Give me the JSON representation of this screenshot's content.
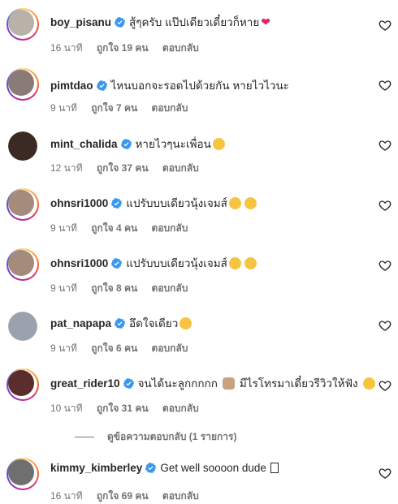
{
  "comments": [
    {
      "username": "boy_pisanu",
      "text": "สู้ๆครับ แป๊ปเดียวเดี๋ยวก็หาย",
      "emojis": [
        "heart"
      ],
      "time": "16 นาที",
      "likes": "ถูกใจ 19 คน",
      "reply": "ตอบกลับ",
      "avatar_ring": true,
      "avatar_color": "#b9b2a8"
    },
    {
      "username": "pimtdao",
      "text": "ไหนบอกจะรอดไปด้วยกัน หายไวไวนะ",
      "emojis": [],
      "time": "9 นาที",
      "likes": "ถูกใจ 7 คน",
      "reply": "ตอบกลับ",
      "avatar_ring": true,
      "avatar_color": "#8a7b77"
    },
    {
      "username": "mint_chalida",
      "text": "หายไวๆนะเพื่อน",
      "emojis": [
        "smile"
      ],
      "time": "12 นาที",
      "likes": "ถูกใจ 37 คน",
      "reply": "ตอบกลับ",
      "avatar_ring": false,
      "avatar_color": "#3b2a24"
    },
    {
      "username": "ohnsri1000",
      "text": "แปรับบบเดียวนุ้งเจมส์",
      "emojis": [
        "smile",
        "smile"
      ],
      "time": "9 นาที",
      "likes": "ถูกใจ 4 คน",
      "reply": "ตอบกลับ",
      "avatar_ring": true,
      "avatar_color": "#a48b7c"
    },
    {
      "username": "ohnsri1000",
      "text": "แปรับบบเดียวนุ้งเจมส์",
      "emojis": [
        "smile",
        "smile"
      ],
      "time": "9 นาที",
      "likes": "ถูกใจ 8 คน",
      "reply": "ตอบกลับ",
      "avatar_ring": true,
      "avatar_color": "#a48b7c"
    },
    {
      "username": "pat_napapa",
      "text": "อึดใจเดียว",
      "emojis": [
        "heart-eyes"
      ],
      "time": "9 นาที",
      "likes": "ถูกใจ 6 คน",
      "reply": "ตอบกลับ",
      "avatar_ring": false,
      "avatar_color": "#9aa3ad"
    },
    {
      "username": "great_rider10",
      "text": "จนได้นะลูกกกกก",
      "text2": "มีไรโทรมาเดี๋ยวรีวิวให้ฟัง",
      "emojis": [
        "muscle",
        "hug"
      ],
      "time": "10 นาที",
      "likes": "ถูกใจ 31 คน",
      "reply": "ตอบกลับ",
      "avatar_ring": true,
      "avatar_color": "#5b2d2d"
    },
    {
      "username": "kimmy_kimberley",
      "text": "Get well soooon dude",
      "emojis": [
        "box"
      ],
      "time": "16 นาที",
      "likes": "ถูกใจ 69 คน",
      "reply": "ตอบกลับ",
      "avatar_ring": true,
      "avatar_color": "#6f6f6f"
    }
  ],
  "view_replies": "ดูข้อความตอบกลับ (1 รายการ)",
  "colors": {
    "verified": "#3897f0",
    "muted": "#737373",
    "text": "#262626"
  },
  "icons": {
    "verified": "verified-badge-icon",
    "like": "heart-outline-icon"
  }
}
